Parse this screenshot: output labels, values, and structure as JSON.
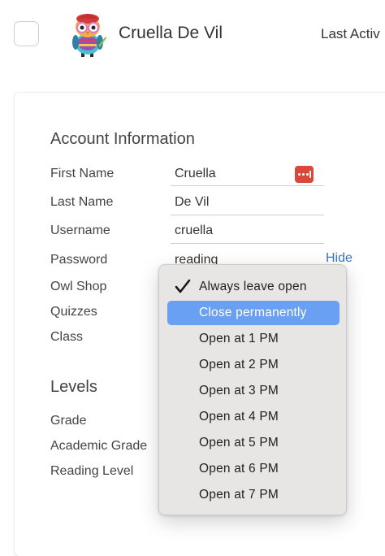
{
  "header": {
    "student_name": "Cruella De Vil",
    "last_active_label": "Last Activ",
    "avatar_icon": "owl-avatar-icon"
  },
  "account": {
    "title": "Account Information",
    "fields": [
      {
        "label": "First Name",
        "value": "Cruella"
      },
      {
        "label": "Last Name",
        "value": "De Vil"
      },
      {
        "label": "Username",
        "value": "cruella"
      },
      {
        "label": "Password",
        "value": "reading"
      },
      {
        "label": "Owl Shop"
      },
      {
        "label": "Quizzes"
      },
      {
        "label": "Class"
      }
    ],
    "password_action": "Hide",
    "password_manager_icon": "password-manager-icon",
    "password_manager_color": "#d9483b"
  },
  "levels": {
    "title": "Levels",
    "fields": [
      {
        "label": "Grade"
      },
      {
        "label": "Academic Grade"
      },
      {
        "label": "Reading Level"
      }
    ]
  },
  "dropdown": {
    "items": [
      {
        "label": "Always leave open",
        "checked": true
      },
      {
        "label": "Close permanently",
        "highlighted": true
      },
      {
        "label": "Open at 1 PM"
      },
      {
        "label": "Open at 2 PM"
      },
      {
        "label": "Open at 3 PM"
      },
      {
        "label": "Open at 4 PM"
      },
      {
        "label": "Open at 5 PM"
      },
      {
        "label": "Open at 6 PM"
      },
      {
        "label": "Open at 7 PM"
      }
    ],
    "highlight_color": "#6aa0f2"
  },
  "colors": {
    "link": "#3b76c4",
    "text": "#444444"
  }
}
